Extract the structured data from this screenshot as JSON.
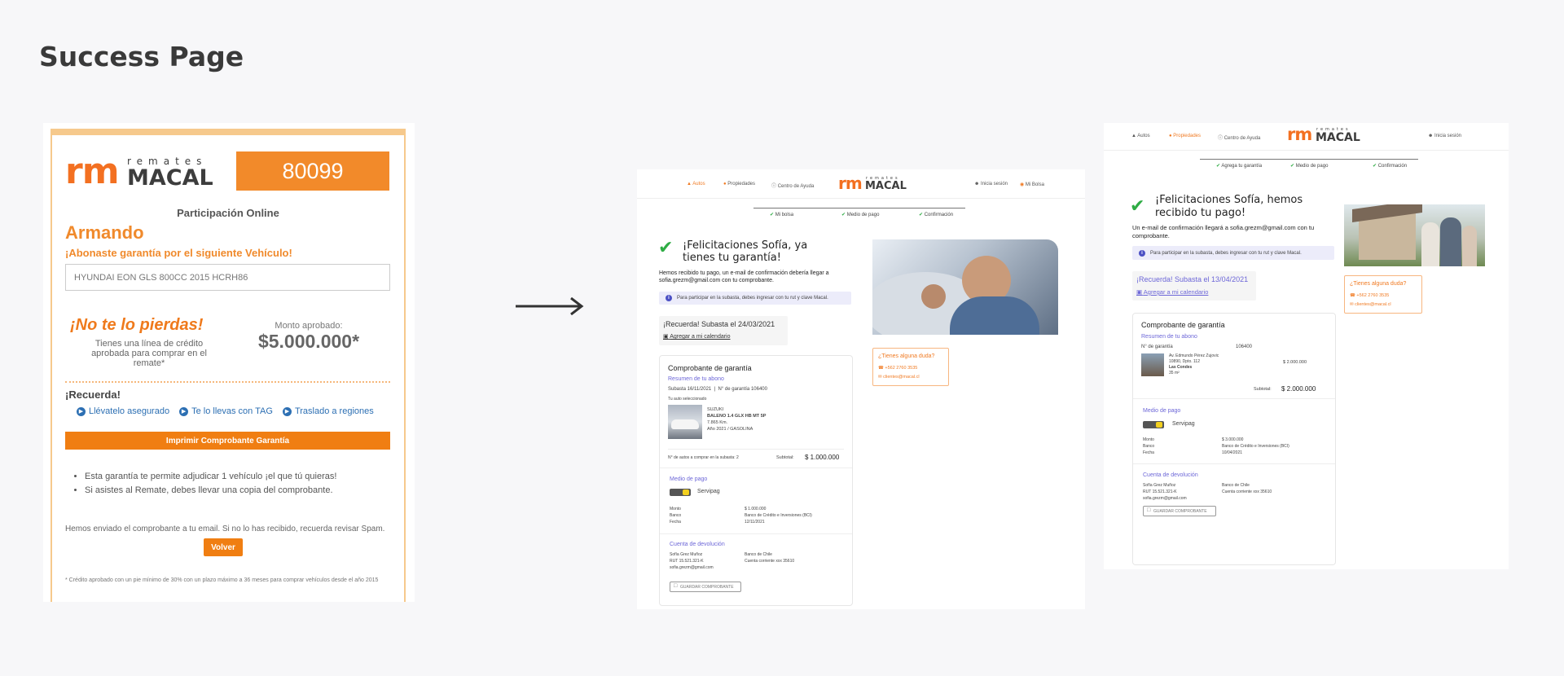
{
  "page_title": "Success Page",
  "old": {
    "logo_rm": "rm",
    "logo_top": "remates",
    "logo_bottom": "MACAL",
    "number": "80099",
    "subtitle": "Participación Online",
    "name": "Armando",
    "abonaste": "¡Abonaste garantía por el siguiente Vehículo!",
    "vehicle": "HYUNDAI EON GLS 800CC 2015 HCRH86",
    "no_lo_pierdas": "¡No te lo pierdas!",
    "credit_text": "Tienes una línea de crédito aprobada para comprar en el remate*",
    "monto_label": "Monto aprobado:",
    "monto_value": "$5.000.000*",
    "recuerda": "¡Recuerda!",
    "links": [
      "Llévatelo asegurado",
      "Te lo llevas con TAG",
      "Traslado a regiones"
    ],
    "print_button": "Imprimir Comprobante Garantía",
    "bullets": [
      "Esta garantía te permite adjudicar 1 vehículo ¡el que tú quieras!",
      "Si asistes al Remate, debes llevar una copia del comprobante."
    ],
    "mail_note": "Hemos enviado el comprobante a tu email. Si no lo has recibido, recuerda revisar Spam.",
    "volver": "Volver",
    "footnote": "* Crédito aprobado con un pie mínimo de 30% con un plazo máximo a 36 meses para comprar vehículos desde el año 2015"
  },
  "p2": {
    "nav": {
      "autos": "Autos",
      "propiedades": "Propiedades",
      "ayuda": "Centro de Ayuda",
      "login": "Inicia sesión",
      "mi_bolsa": "Mi Bolsa"
    },
    "logo_rm": "rm",
    "logo_top": "remates",
    "logo_bottom": "MACAL",
    "steps": [
      "Mi bolsa",
      "Medio de pago",
      "Confirmación"
    ],
    "heading": "¡Felicitaciones Sofía, ya tienes tu garantía!",
    "body": "Hemos recibido tu pago, un e-mail de confirmación debería llegar a sofia.grezm@gmail.com con tu comprobante.",
    "info": "Para participar en la subasta, debes ingresar con tu rut y clave Macal.",
    "recuerda": "¡Recuerda! Subasta el 24/03/2021",
    "calendar": "Agregar a mi calendario",
    "card_title": "Comprobante de garantía",
    "resumen": "Resumen de tu abono",
    "subasta": "Subasta 16/11/2021",
    "garantia": "N° de garantía 106400",
    "auto_sel": "Tu auto seleccionado",
    "car": [
      "SUZUKI",
      "BALENO 1.4 GLX HB MT 5P",
      "7.865 Km.",
      "Año 2021 / GASOLINA"
    ],
    "n_autos": "N° de autos a comprar en la subasta: 2",
    "subtotal_label": "Subtotal:",
    "subtotal": "$ 1.000.000",
    "medio_pago": "Medio de pago",
    "servipag": "Servipag",
    "pay_rows": [
      [
        "Monto",
        "$ 1.000.000"
      ],
      [
        "Banco",
        "Banco de Crédito e Inversiones (BCI)"
      ],
      [
        "Fecha",
        "12/11/2021"
      ]
    ],
    "cuenta": "Cuenta de devolución",
    "cuenta_rows": [
      [
        "Sofía Grez Muñoz",
        "Banco de Chile"
      ],
      [
        "RUT 15.521.321-K",
        "Cuenta corriente xxx 35610"
      ],
      [
        "sofia.grezm@gmail.com",
        ""
      ]
    ],
    "guardar": "GUARDAR COMPROBANTE",
    "duda_title": "¿Tienes alguna duda?",
    "phone": "+562 2760 3535",
    "email": "clientes@macal.cl"
  },
  "p3": {
    "nav": {
      "autos": "Autos",
      "propiedades": "Propiedades",
      "ayuda": "Centro de Ayuda",
      "login": "Inicia sesión"
    },
    "logo_rm": "rm",
    "logo_top": "remates",
    "logo_bottom": "MACAL",
    "steps": [
      "Agrega tu garantía",
      "Medio de pago",
      "Confirmación"
    ],
    "heading": "¡Felicitaciones Sofía, hemos recibido tu pago!",
    "body": "Un e-mail de confirmación llegará a sofia.grezm@gmail.com con tu comprobante.",
    "info": "Para participar en la subasta, debes ingresar con tu rut y clave Macal.",
    "recuerda": "¡Recuerda! Subasta el 13/04/2021",
    "calendar": "Agregar a mi calendario",
    "card_title": "Comprobante de garantía",
    "resumen": "Resumen de tu abono",
    "garantia_label": "N° de garantía",
    "garantia": "106400",
    "prop": [
      "Av. Edmundo Pérez Zujovic",
      "10890, Dpto. 112",
      "Las Condes",
      "35 m²"
    ],
    "prop_price": "$ 2.000.000",
    "subtotal_label": "Subtotal:",
    "subtotal": "$ 2.000.000",
    "medio_pago": "Medio de pago",
    "servipag": "Servipag",
    "pay_rows": [
      [
        "Monto",
        "$ 3.000.000"
      ],
      [
        "Banco",
        "Banco de Crédito e Inversiones (BCI)"
      ],
      [
        "Fecha",
        "10/04/2021"
      ]
    ],
    "cuenta": "Cuenta de devolución",
    "cuenta_rows": [
      [
        "Sofía Grez Muñoz",
        "Banco de Chile"
      ],
      [
        "RUT 15.521.321-K",
        "Cuenta corriente xxx 35610"
      ],
      [
        "sofia.grezm@gmail.com",
        ""
      ]
    ],
    "guardar": "GUARDAR COMPROBANTE",
    "duda_title": "¿Tienes alguna duda?",
    "phone": "+562 2760 3535",
    "email": "clientes@macal.cl"
  },
  "colors": {
    "brand_orange": "#f37021",
    "accent_purple": "#6d67d8",
    "success_green": "#2eac44"
  }
}
